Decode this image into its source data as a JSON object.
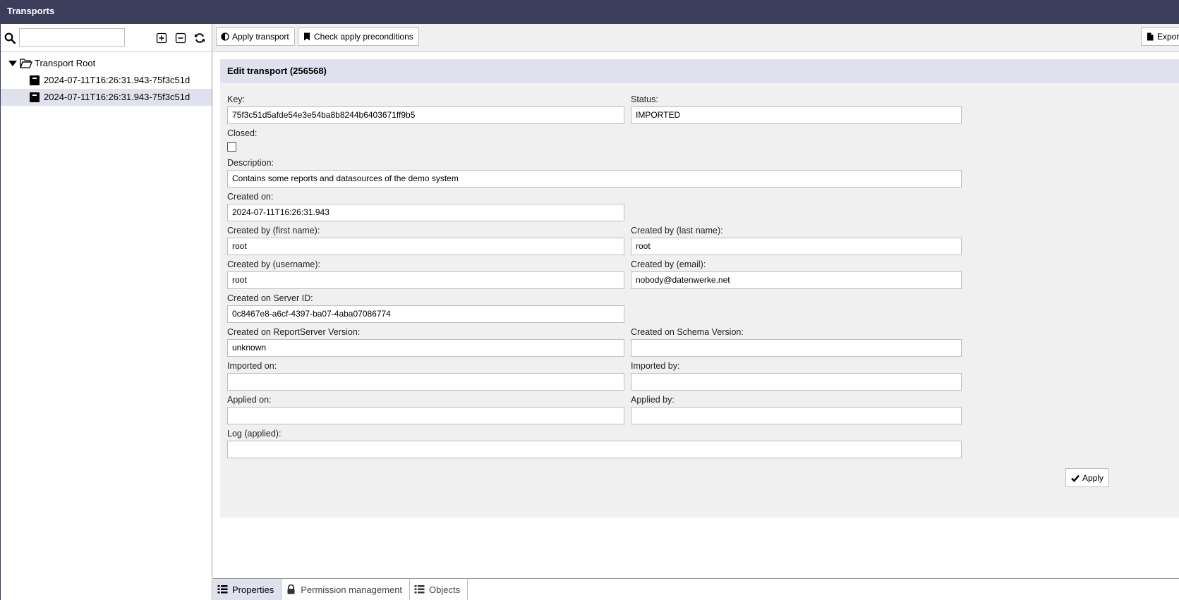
{
  "window": {
    "title": "Transports"
  },
  "left": {
    "search": {
      "value": "",
      "placeholder": ""
    },
    "tree": {
      "root": "Transport Root",
      "children": [
        {
          "label": "2024-07-11T16:26:31.943-75f3c51d",
          "selected": false
        },
        {
          "label": "2024-07-11T16:26:31.943-75f3c51d",
          "selected": true
        }
      ]
    }
  },
  "toolbar": {
    "apply_transport": "Apply transport",
    "check_preconditions": "Check apply preconditions",
    "export": "Export"
  },
  "form": {
    "title": "Edit transport (256568)",
    "key_label": "Key:",
    "key_value": "75f3c51d5afde54e3e54ba8b8244b6403671ff9b5",
    "status_label": "Status:",
    "status_value": "IMPORTED",
    "closed_label": "Closed:",
    "closed_checked": false,
    "description_label": "Description:",
    "description_value": "Contains some reports and datasources of the demo system",
    "created_on_label": "Created on:",
    "created_on_value": "2024-07-11T16:26:31.943",
    "first_name_label": "Created by (first name):",
    "first_name_value": "root",
    "last_name_label": "Created by (last name):",
    "last_name_value": "root",
    "username_label": "Created by (username):",
    "username_value": "root",
    "email_label": "Created by (email):",
    "email_value": "nobody@datenwerke.net",
    "server_id_label": "Created on Server ID:",
    "server_id_value": "0c8467e8-a6cf-4397-ba07-4aba07086774",
    "rs_version_label": "Created on ReportServer Version:",
    "rs_version_value": "unknown",
    "schema_version_label": "Created on Schema Version:",
    "schema_version_value": "",
    "imported_on_label": "Imported on:",
    "imported_on_value": "",
    "imported_by_label": "Imported by:",
    "imported_by_value": "",
    "applied_on_label": "Applied on:",
    "applied_on_value": "",
    "applied_by_label": "Applied by:",
    "applied_by_value": "",
    "log_label": "Log (applied):",
    "log_value": "",
    "apply_button": "Apply"
  },
  "tabs": [
    {
      "label": "Properties",
      "active": true
    },
    {
      "label": "Permission management",
      "active": false
    },
    {
      "label": "Objects",
      "active": false
    }
  ]
}
